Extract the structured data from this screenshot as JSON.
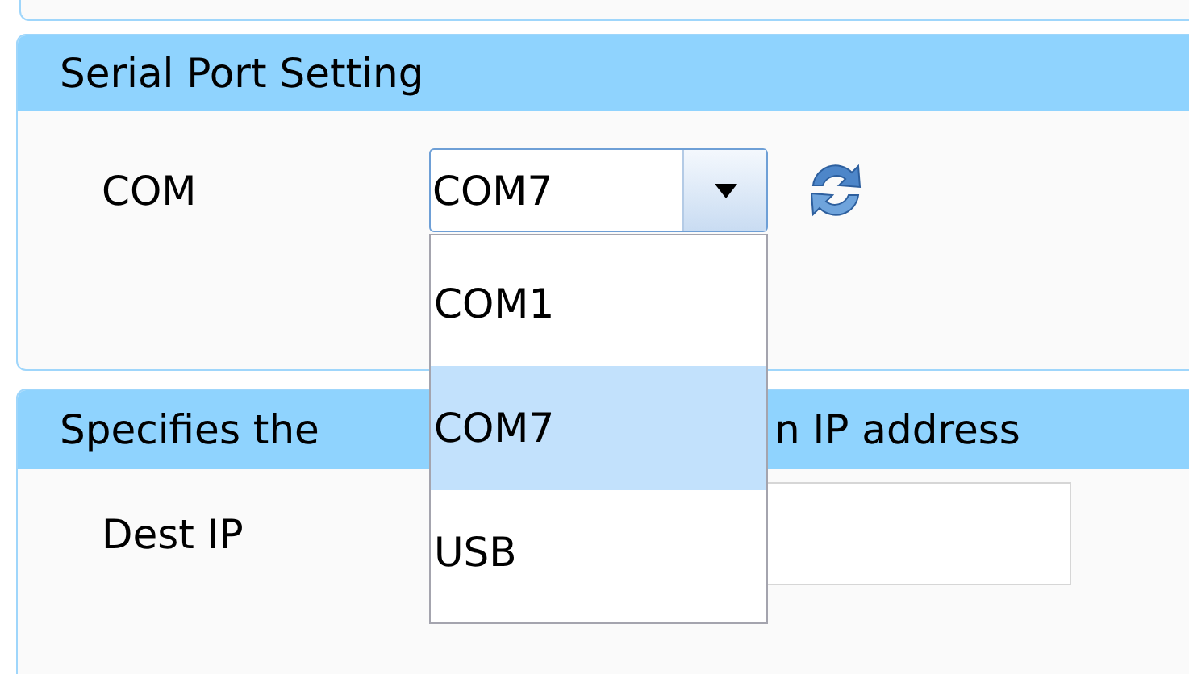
{
  "serial_port_setting": {
    "title": "Serial Port Setting",
    "com": {
      "label": "COM",
      "value": "COM7",
      "expanded": true,
      "options": [
        {
          "label": "COM1",
          "selected": false
        },
        {
          "label": "COM7",
          "selected": true
        },
        {
          "label": "USB",
          "selected": false
        }
      ]
    }
  },
  "ip_section": {
    "title_parts": [
      "Specifies the",
      "n IP address"
    ],
    "dest_ip": {
      "label": "Dest IP"
    }
  }
}
